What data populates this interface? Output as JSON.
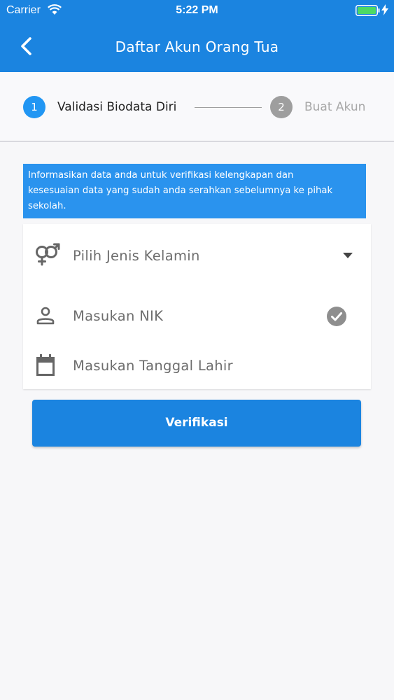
{
  "status_bar": {
    "carrier": "Carrier",
    "time": "5:22 PM"
  },
  "header": {
    "title": "Daftar Akun Orang Tua"
  },
  "stepper": {
    "steps": [
      {
        "number": "1",
        "label": "Validasi Biodata Diri",
        "active": true
      },
      {
        "number": "2",
        "label": "Buat Akun",
        "active": false
      }
    ]
  },
  "info_banner": {
    "lines": [
      "Informasikan data anda untuk verifikasi kelengkapan dan",
      "kesesuaian data yang sudah anda serahkan sebelumnya ke pihak",
      "sekolah."
    ]
  },
  "form": {
    "gender_select": {
      "placeholder": "Pilih Jenis Kelamin",
      "icon": "gender-icon"
    },
    "nik_input": {
      "placeholder": "Masukan NIK",
      "icon": "person-icon",
      "status_icon": "check-circle-icon"
    },
    "birthdate_input": {
      "placeholder": "Masukan Tanggal Lahir",
      "icon": "calendar-icon"
    }
  },
  "actions": {
    "verify_label": "Verifikasi"
  },
  "colors": {
    "primary": "#1b84e0",
    "banner": "#2a93ee",
    "step_active": "#2196f3",
    "step_inactive": "#9e9e9e"
  }
}
